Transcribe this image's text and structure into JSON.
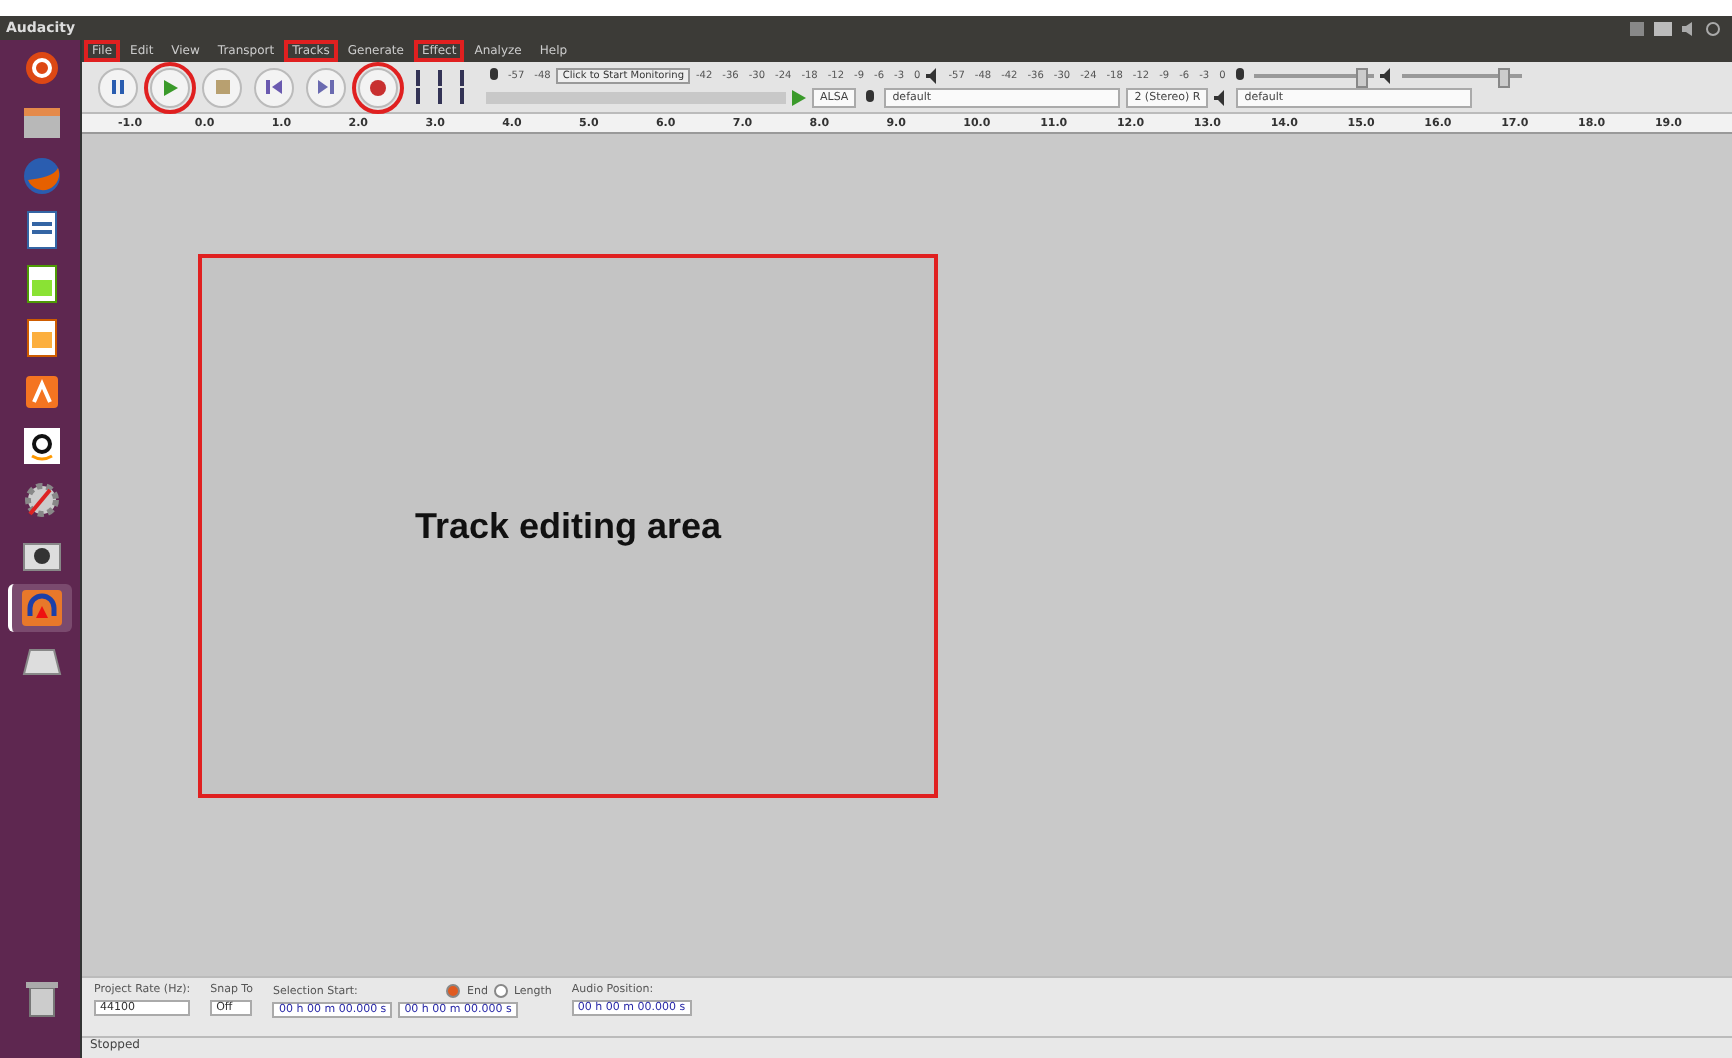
{
  "window": {
    "title": "Audacity"
  },
  "launcher": [
    {
      "kind": "ubuntu"
    },
    {
      "kind": "files"
    },
    {
      "kind": "browser"
    },
    {
      "kind": "writer"
    },
    {
      "kind": "calc"
    },
    {
      "kind": "impress"
    },
    {
      "kind": "software"
    },
    {
      "kind": "amazon"
    },
    {
      "kind": "settings"
    },
    {
      "kind": "camera"
    },
    {
      "kind": "audio",
      "selected": true
    },
    {
      "kind": "disk"
    },
    {
      "kind": "trash"
    }
  ],
  "menu": [
    {
      "label": "File",
      "highlighted": true
    },
    {
      "label": "Edit",
      "highlighted": false
    },
    {
      "label": "View",
      "highlighted": false
    },
    {
      "label": "Transport",
      "highlighted": false
    },
    {
      "label": "Tracks",
      "highlighted": true
    },
    {
      "label": "Generate",
      "highlighted": false
    },
    {
      "label": "Effect",
      "highlighted": true
    },
    {
      "label": "Analyze",
      "highlighted": false
    },
    {
      "label": "Help",
      "highlighted": false
    }
  ],
  "transport": [
    {
      "kind": "pause",
      "highlighted": false
    },
    {
      "kind": "play",
      "highlighted": true
    },
    {
      "kind": "stop",
      "highlighted": false
    },
    {
      "kind": "skip-start",
      "highlighted": false
    },
    {
      "kind": "skip-end",
      "highlighted": false
    },
    {
      "kind": "record",
      "highlighted": true
    }
  ],
  "record_meter": {
    "button": "Click to Start Monitoring",
    "scale": [
      "-57",
      "-48",
      "-42",
      "-36",
      "-30",
      "-24",
      "-18",
      "-12",
      "-9",
      "-6",
      "-3",
      "0"
    ]
  },
  "play_meter": {
    "scale": [
      "-57",
      "-48",
      "-42",
      "-36",
      "-30",
      "-24",
      "-18",
      "-12",
      "-9",
      "-6",
      "-3",
      "0"
    ]
  },
  "device_toolbar": {
    "host": "ALSA",
    "recording_device": "default",
    "channels": "2 (Stereo) R",
    "playback_device": "default"
  },
  "ruler": [
    "-1.0",
    "0.0",
    "1.0",
    "2.0",
    "3.0",
    "4.0",
    "5.0",
    "6.0",
    "7.0",
    "8.0",
    "9.0",
    "10.0",
    "11.0",
    "12.0",
    "13.0",
    "14.0",
    "15.0",
    "16.0",
    "17.0",
    "18.0",
    "19.0"
  ],
  "track_area": {
    "annotation": "Track editing area",
    "highlighted": true
  },
  "selection_toolbar": {
    "rate_label": "Project Rate (Hz):",
    "rate": "44100",
    "snap_label": "Snap To",
    "snap": "Off",
    "start_label": "Selection Start:",
    "end_label": "End",
    "end_selected": true,
    "length_label": "Length",
    "length_selected": false,
    "position_label": "Audio Position:",
    "start": "00 h 00 m 00.000 s",
    "end": "00 h 00 m 00.000 s",
    "position": "00 h 00 m 00.000 s"
  },
  "status_bar": "Stopped"
}
